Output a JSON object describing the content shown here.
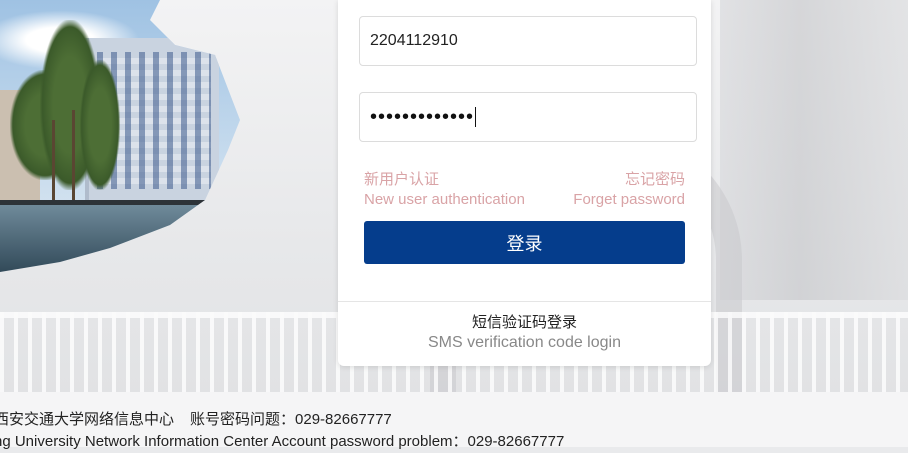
{
  "login": {
    "username_value": "2204112910",
    "password_mask": "•••••••••••••",
    "new_user_cn": "新用户认证",
    "new_user_en": "New user authentication",
    "forget_cn": "忘记密码",
    "forget_en": "Forget password",
    "login_button": "登录",
    "sms_cn": "短信验证码登录",
    "sms_en": "SMS verification code login"
  },
  "footer": {
    "line1_org": "西安交通大学网络信息中心",
    "line1_help": "账号密码问题：029-82667777",
    "line2": "ng University Network Information Center   Account password problem：029-82667777"
  },
  "colors": {
    "primary": "#053d8c",
    "link": "#d9a3a6"
  }
}
